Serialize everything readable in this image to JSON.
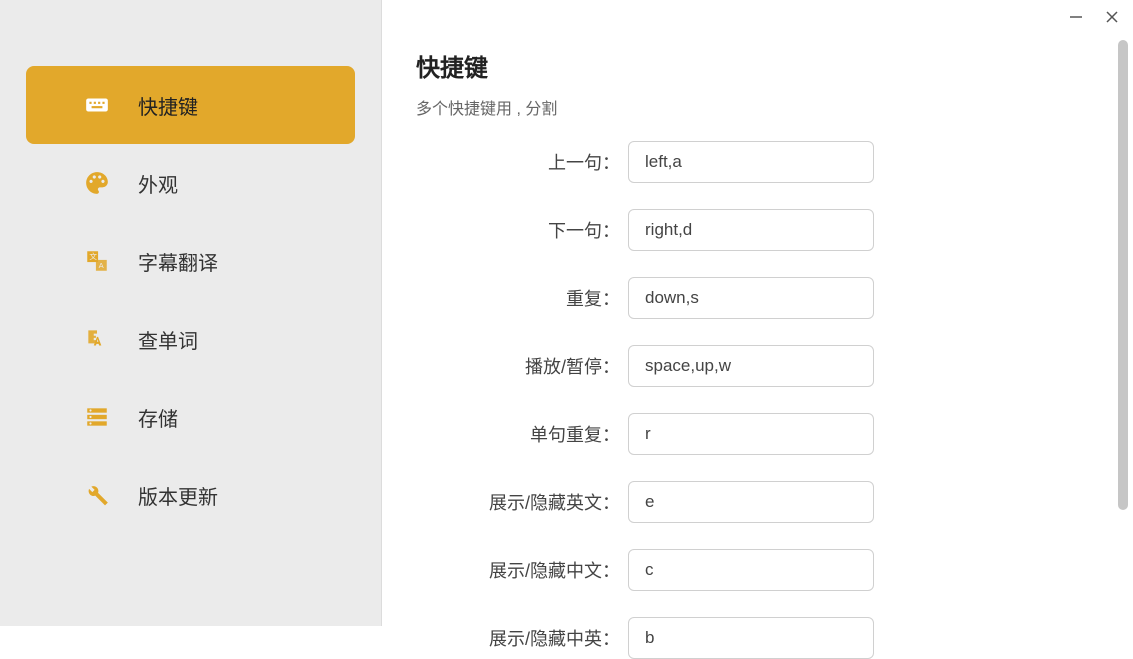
{
  "window": {
    "minimize": "minimize",
    "close": "close"
  },
  "sidebar": {
    "items": [
      {
        "label": "快捷键",
        "icon": "keyboard-icon"
      },
      {
        "label": "外观",
        "icon": "palette-icon"
      },
      {
        "label": "字幕翻译",
        "icon": "translate-icon"
      },
      {
        "label": "查单词",
        "icon": "dictionary-icon"
      },
      {
        "label": "存储",
        "icon": "storage-icon"
      },
      {
        "label": "版本更新",
        "icon": "wrench-icon"
      }
    ]
  },
  "page": {
    "title": "快捷键",
    "subtitle": "多个快捷键用 , 分割"
  },
  "shortcuts": [
    {
      "label": "上一句：",
      "value": "left,a"
    },
    {
      "label": "下一句：",
      "value": "right,d"
    },
    {
      "label": "重复：",
      "value": "down,s"
    },
    {
      "label": "播放/暂停：",
      "value": "space,up,w"
    },
    {
      "label": "单句重复：",
      "value": "r"
    },
    {
      "label": "展示/隐藏英文：",
      "value": "e"
    },
    {
      "label": "展示/隐藏中文：",
      "value": "c"
    },
    {
      "label": "展示/隐藏中英：",
      "value": "b"
    }
  ]
}
